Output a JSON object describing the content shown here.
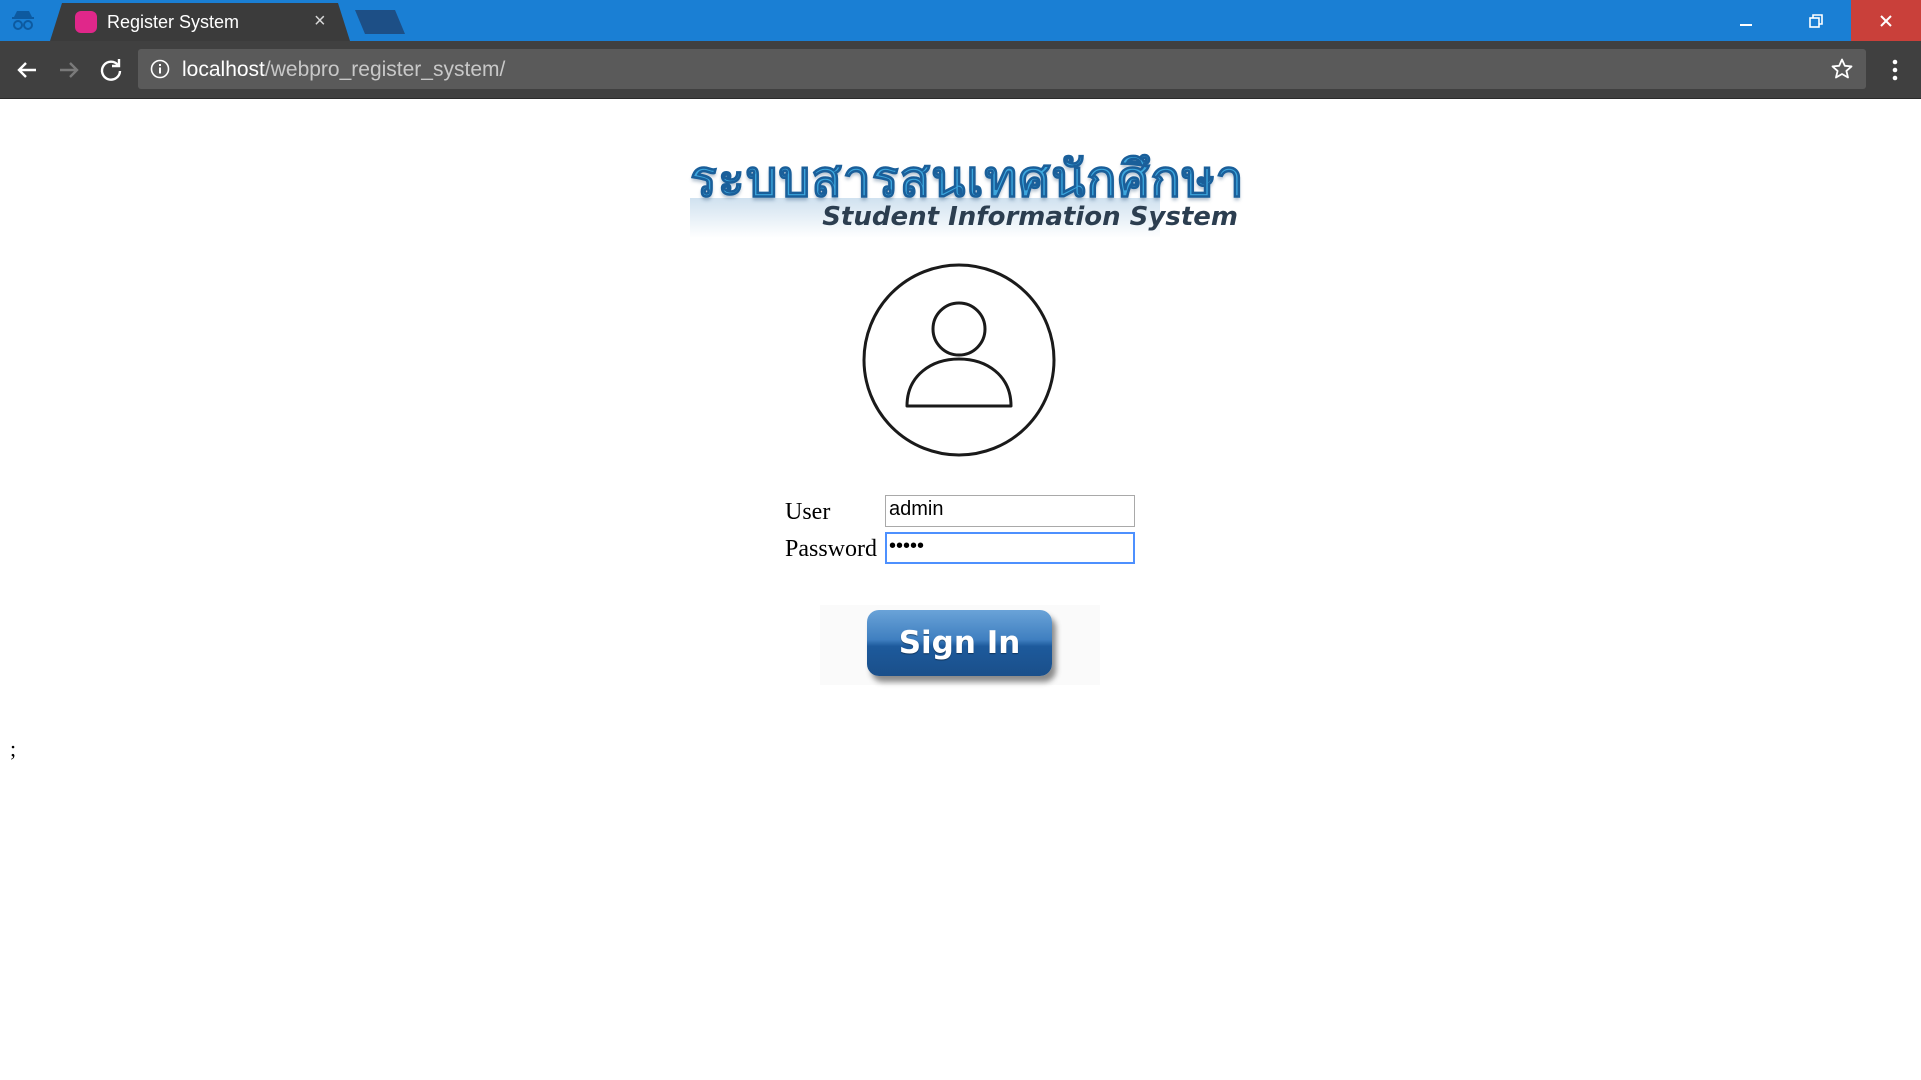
{
  "browser": {
    "tab_title": "Register System",
    "tab_close": "×",
    "url_host": "localhost",
    "url_path": "/webpro_register_system/",
    "window_controls": {
      "minimize": "—",
      "restore": "❐",
      "close": "✕"
    },
    "accent_color": "#1a7fd4"
  },
  "page": {
    "logo": {
      "thai_text": "ระบบสารสนเทศนักศึกษา",
      "english_text": "Student Information System"
    },
    "form": {
      "user_label": "User",
      "user_value": "admin",
      "password_label": "Password",
      "password_value": "•••••"
    },
    "signin_label": "Sign In",
    "stray_text": ";"
  }
}
